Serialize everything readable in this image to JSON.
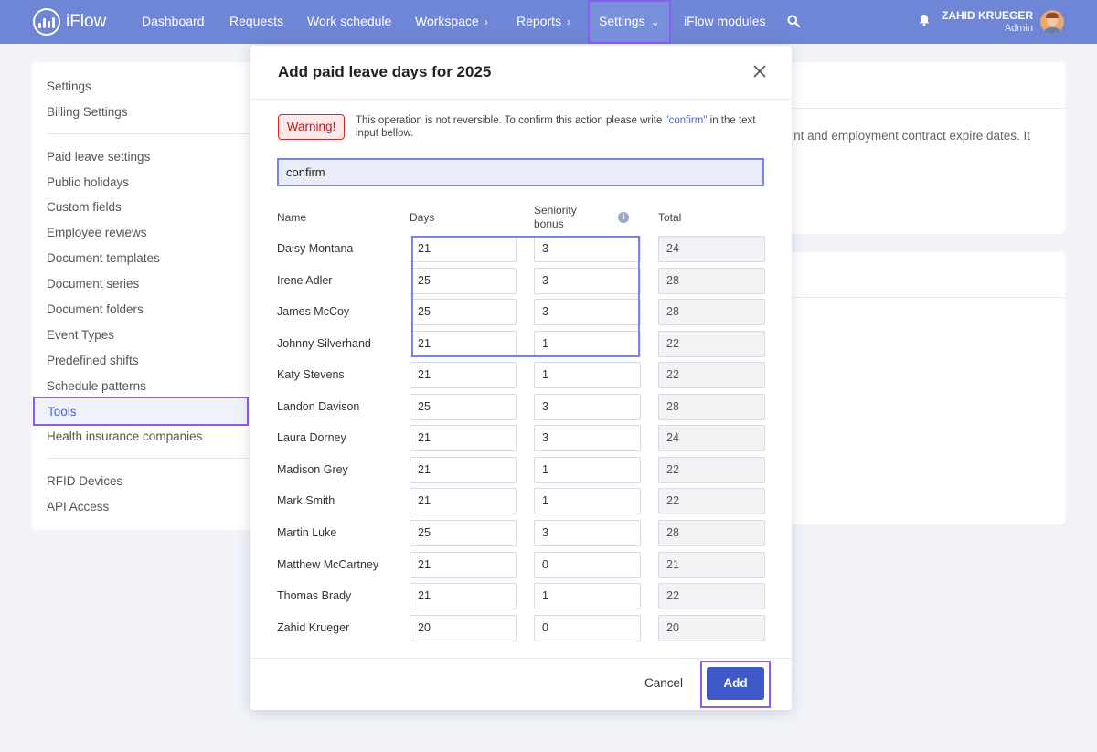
{
  "nav": {
    "brand": "iFlow",
    "items": [
      {
        "label": "Dashboard",
        "chevron": ""
      },
      {
        "label": "Requests",
        "chevron": ""
      },
      {
        "label": "Work schedule",
        "chevron": ""
      },
      {
        "label": "Workspace",
        "chevron": "›"
      },
      {
        "label": "Reports",
        "chevron": "›"
      },
      {
        "label": "Settings",
        "chevron": "⌄"
      },
      {
        "label": "iFlow modules",
        "chevron": ""
      }
    ],
    "user_name": "ZAHID KRUEGER",
    "user_role": "Admin"
  },
  "sidebar": {
    "group1": [
      "Settings",
      "Billing Settings"
    ],
    "group2": [
      "Paid leave settings",
      "Public holidays",
      "Custom fields",
      "Employee reviews",
      "Document templates",
      "Document series",
      "Document folders",
      "Event Types",
      "Predefined shifts",
      "Schedule patterns",
      "Tools",
      "Health insurance companies"
    ],
    "group3": [
      "RFID Devices",
      "API Access"
    ],
    "active": "Tools"
  },
  "background": {
    "card1_text": "nt and employment contract expire dates. It"
  },
  "modal": {
    "title": "Add paid leave days for 2025",
    "warning_badge": "Warning!",
    "warning_text_before": "This operation is not reversible. To confirm this action please write ",
    "warning_keyword": "\"confirm\"",
    "warning_text_after": " in the text input bellow.",
    "confirm_value": "confirm",
    "headers": {
      "name": "Name",
      "days": "Days",
      "bonus_line1": "Seniority",
      "bonus_line2": "bonus",
      "total": "Total"
    },
    "rows": [
      {
        "name": "Daisy Montana",
        "days": "21",
        "bonus": "3",
        "total": "24"
      },
      {
        "name": "Irene Adler",
        "days": "25",
        "bonus": "3",
        "total": "28"
      },
      {
        "name": "James McCoy",
        "days": "25",
        "bonus": "3",
        "total": "28"
      },
      {
        "name": "Johnny Silverhand",
        "days": "21",
        "bonus": "1",
        "total": "22"
      },
      {
        "name": "Katy Stevens",
        "days": "21",
        "bonus": "1",
        "total": "22"
      },
      {
        "name": "Landon Davison",
        "days": "25",
        "bonus": "3",
        "total": "28"
      },
      {
        "name": "Laura Dorney",
        "days": "21",
        "bonus": "3",
        "total": "24"
      },
      {
        "name": "Madison Grey",
        "days": "21",
        "bonus": "1",
        "total": "22"
      },
      {
        "name": "Mark Smith",
        "days": "21",
        "bonus": "1",
        "total": "22"
      },
      {
        "name": "Martin Luke",
        "days": "25",
        "bonus": "3",
        "total": "28"
      },
      {
        "name": "Matthew McCartney",
        "days": "21",
        "bonus": "0",
        "total": "21"
      },
      {
        "name": "Thomas Brady",
        "days": "21",
        "bonus": "1",
        "total": "22"
      },
      {
        "name": "Zahid Krueger",
        "days": "20",
        "bonus": "0",
        "total": "20"
      }
    ],
    "cancel_label": "Cancel",
    "add_label": "Add"
  },
  "colors": {
    "nav_bg": "#6f86d6",
    "accent": "#3f5ac8",
    "highlight": "#8a5cf0",
    "warning": "#c21c1c"
  }
}
